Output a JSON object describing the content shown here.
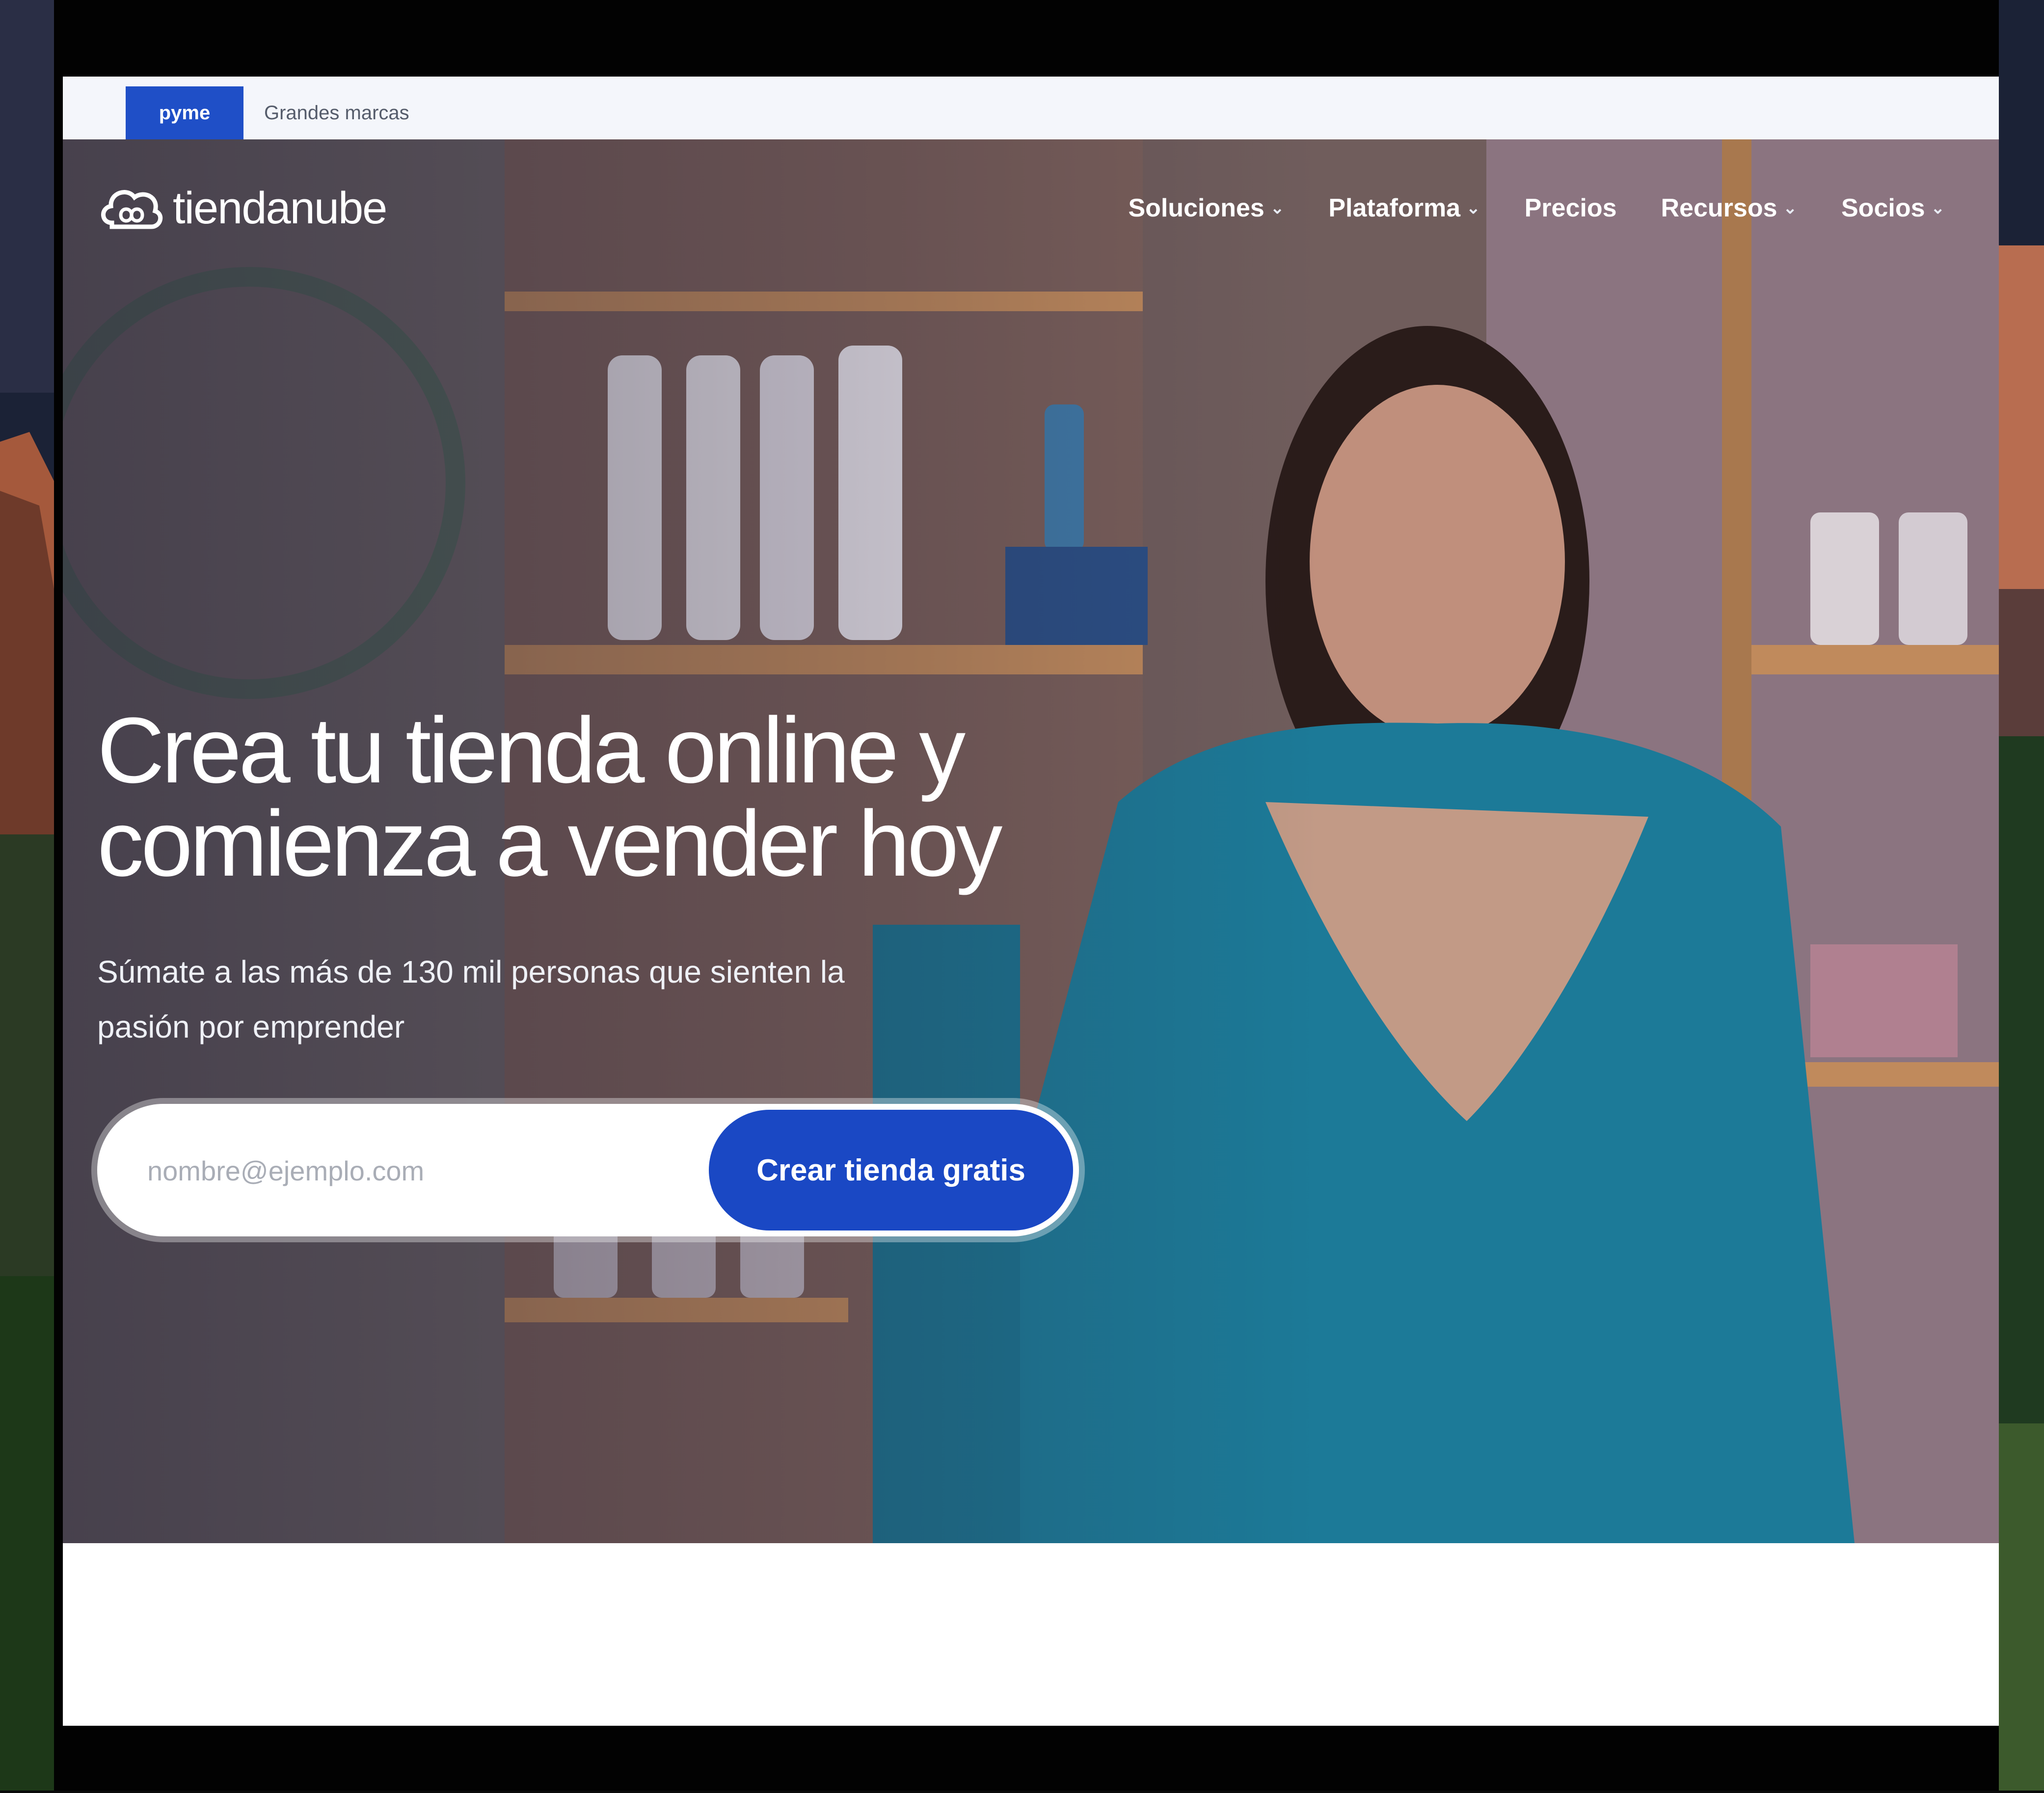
{
  "topbar": {
    "active_tab": "pyme",
    "other_tab": "Grandes marcas"
  },
  "brand": {
    "name": "tiendanube",
    "accent_color": "#1a48c4"
  },
  "nav": {
    "items": [
      {
        "label": "Soluciones",
        "has_dropdown": true
      },
      {
        "label": "Plataforma",
        "has_dropdown": true
      },
      {
        "label": "Precios",
        "has_dropdown": false
      },
      {
        "label": "Recursos",
        "has_dropdown": true
      },
      {
        "label": "Socios",
        "has_dropdown": true
      }
    ],
    "chevron_glyph": "⌄"
  },
  "hero": {
    "headline": "Crea tu tienda online y comienza a vender hoy",
    "subhead": "Súmate a las más de 130 mil personas que sienten la pasión por emprender",
    "email_placeholder": "nombre@ejemplo.com",
    "cta_label": "Crear tienda gratis"
  },
  "icons": {
    "logo": "cloud-infinity-logo-icon",
    "dropdown": "chevron-down-icon"
  }
}
